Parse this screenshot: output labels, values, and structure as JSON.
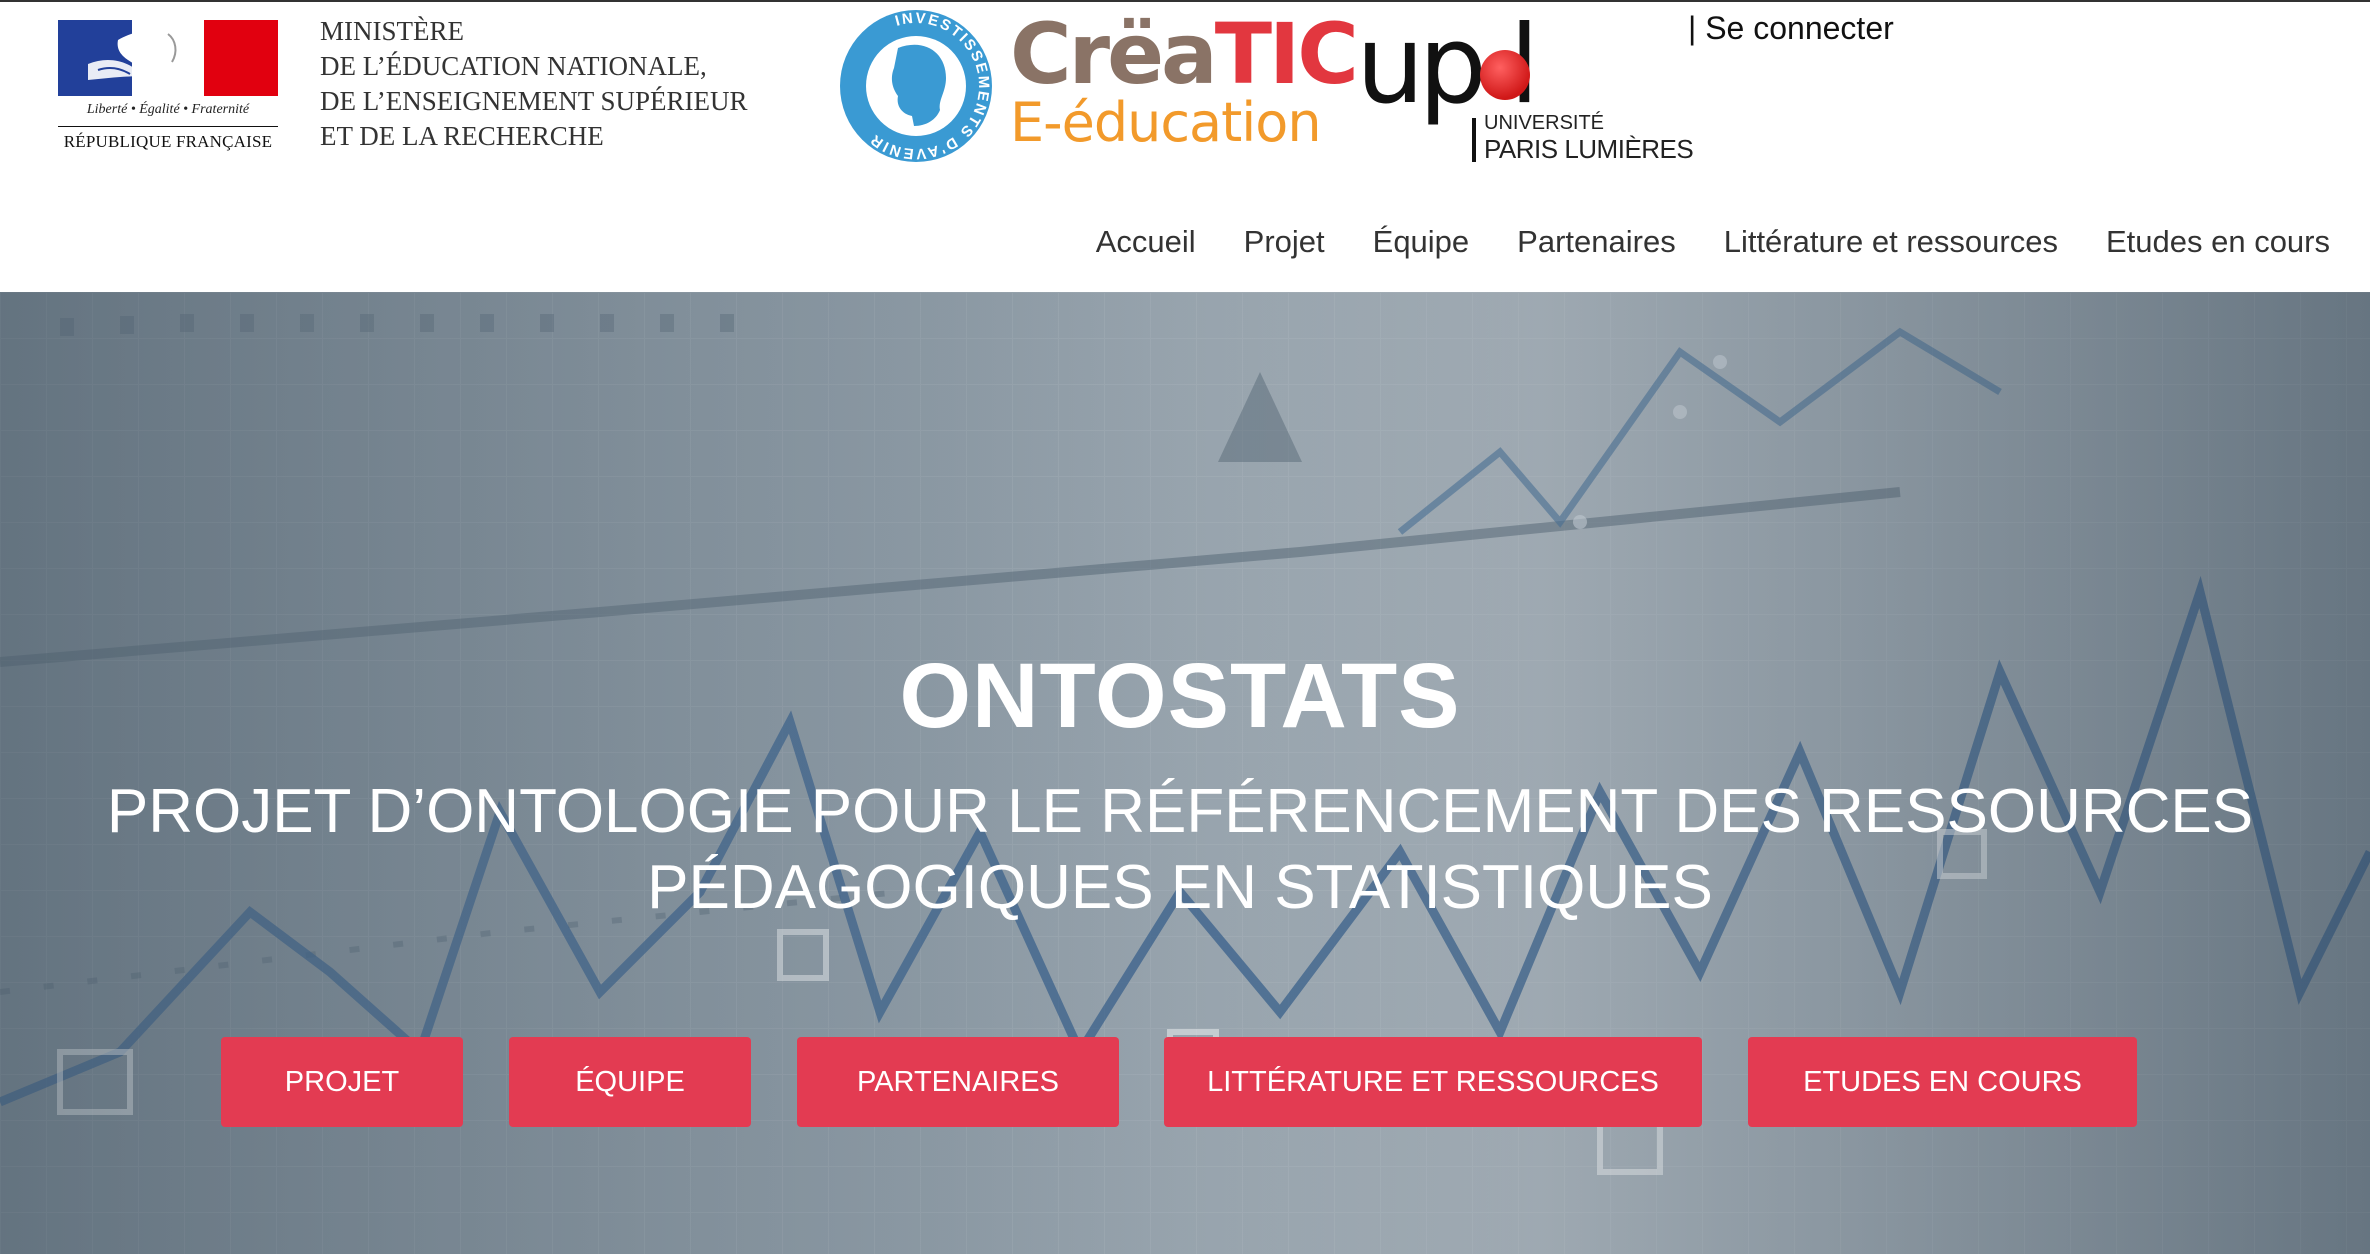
{
  "header": {
    "republic": {
      "motto": "Liberté • Égalité • Fraternité",
      "name": "RÉPUBLIQUE FRANÇAISE"
    },
    "ministry_lines": [
      "MINISTÈRE",
      "DE L’ÉDUCATION NATIONALE,",
      "DE L’ENSEIGNEMENT SUPÉRIEUR",
      "ET DE LA RECHERCHE"
    ],
    "ia_logo": {
      "ring_text": "INVESTISSEMENTS D'AVENIR"
    },
    "creatic": {
      "part1": "Crëa",
      "part2": "TIC",
      "line2": "E-éducation"
    },
    "upl": {
      "letters": "up l",
      "line1": "UNIVERSITÉ",
      "line2": "PARIS LUMIÈRES"
    },
    "connect_label": "| Se connecter"
  },
  "nav": {
    "items": [
      "Accueil",
      "Projet",
      "Équipe",
      "Partenaires",
      "Littérature et ressources",
      "Etudes en cours"
    ]
  },
  "hero": {
    "title": "ONTOSTATS",
    "subtitle_line1": "PROJET D’ONTOLOGIE POUR LE RÉFÉRENCEMENT DES RESSOURCES",
    "subtitle_line2": "PÉDAGOGIQUES EN STATISTIQUES",
    "buttons": [
      "PROJET",
      "ÉQUIPE",
      "PARTENAIRES",
      "LITTÉRATURE ET RESSOURCES",
      "ETUDES EN COURS"
    ]
  },
  "colors": {
    "accent": "#e33b52",
    "nav_text": "#333333",
    "hero_overlay": "#7c8a95"
  }
}
